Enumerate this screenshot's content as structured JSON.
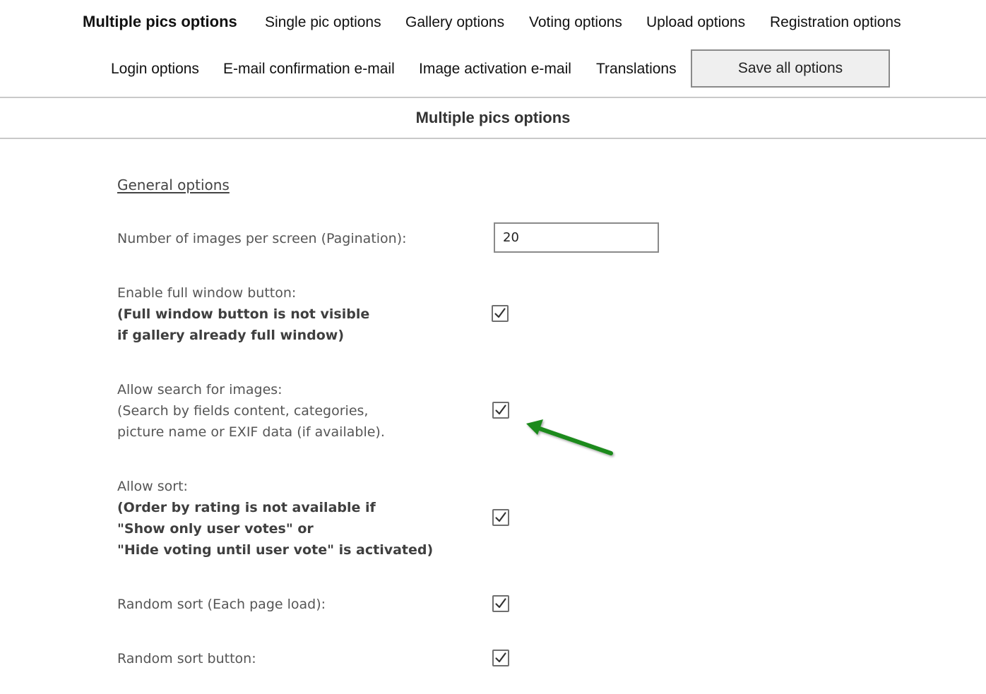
{
  "tabs": {
    "multiple_pics": "Multiple pics options",
    "single_pic": "Single pic options",
    "gallery": "Gallery options",
    "voting": "Voting options",
    "upload": "Upload options",
    "registration": "Registration options",
    "login": "Login options",
    "email_confirmation": "E-mail confirmation e-mail",
    "image_activation": "Image activation e-mail",
    "translations": "Translations"
  },
  "save_button": "Save all options",
  "section_title": "Multiple pics options",
  "general_options": {
    "title": "General options",
    "pagination": {
      "label": "Number of images per screen (Pagination):",
      "value": "20"
    },
    "full_window": {
      "label": "Enable full window button:",
      "note_line1": "(Full window button is not visible",
      "note_line2": "if gallery already full window)",
      "checked": true
    },
    "search": {
      "label": "Allow search for images:",
      "note_line1": "(Search by fields content, categories,",
      "note_line2": "picture name or EXIF data (if available).",
      "checked": true
    },
    "sort": {
      "label": "Allow sort:",
      "note_line1": "(Order by rating is not available if",
      "note_line2": "\"Show only user votes\" or",
      "note_line3": "\"Hide voting until user vote\" is activated)",
      "checked": true
    },
    "random_sort": {
      "label": "Random sort (Each page load):",
      "checked": true
    },
    "random_sort_button": {
      "label": "Random sort button:",
      "checked": true
    }
  },
  "colors": {
    "arrow": "#1e8a1e",
    "divider": "#c9c9c9",
    "button_bg": "#efefef"
  },
  "icons": {
    "checkmark": "checkmark-icon",
    "annotation": "arrow-icon"
  }
}
